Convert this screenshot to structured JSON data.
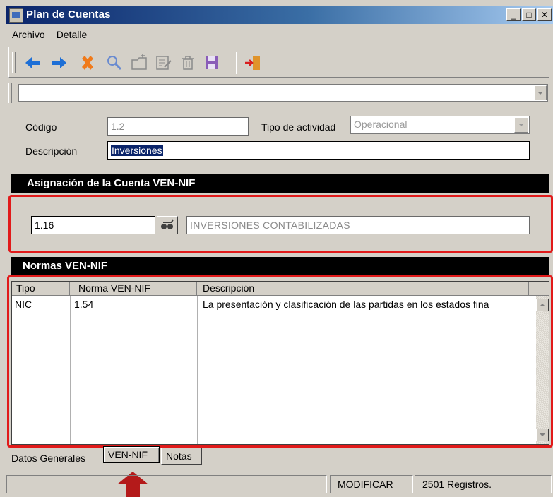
{
  "window": {
    "title": "Plan de Cuentas"
  },
  "menu": {
    "items": [
      "Archivo",
      "Detalle"
    ]
  },
  "toolbar": {
    "icons": [
      "back-arrow",
      "forward-arrow",
      "delete-x",
      "search",
      "new-folder",
      "edit",
      "trash",
      "save",
      "exit-door"
    ]
  },
  "form": {
    "codigo_label": "Código",
    "codigo_value": "1.2",
    "tipo_actividad_label": "Tipo de actividad",
    "tipo_actividad_value": "Operacional",
    "descripcion_label": "Descripción",
    "descripcion_value": "Inversiones"
  },
  "asignacion": {
    "header": "Asignación de la Cuenta VEN-NIF",
    "code_value": "1.16",
    "description_value": "INVERSIONES CONTABILIZADAS"
  },
  "normas": {
    "header": "Normas VEN-NIF",
    "columns": [
      "Tipo",
      "Norma VEN-NIF",
      "Descripción"
    ],
    "rows": [
      {
        "tipo": "NIC",
        "norma": "1.54",
        "descripcion": "La presentación y clasificación de las partidas en los estados fina"
      }
    ]
  },
  "tabs": [
    "Datos Generales",
    "VEN-NIF",
    "Notas"
  ],
  "status": {
    "mode": "MODIFICAR",
    "records": "2501 Registros."
  },
  "colors": {
    "highlight": "#e11a1a",
    "arrow": "#b41a1a",
    "title_bar": "#0a246a"
  }
}
